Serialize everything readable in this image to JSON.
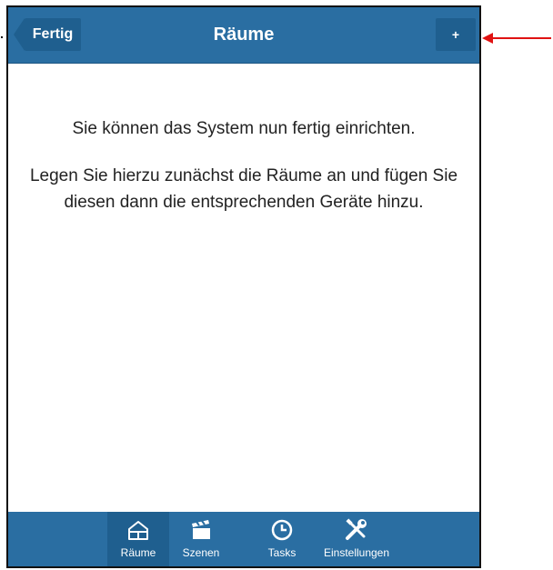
{
  "header": {
    "back_label": "Fertig",
    "title": "Räume",
    "add_label": "+"
  },
  "content": {
    "line1": "Sie können das System nun fertig einrichten.",
    "line2": "Legen Sie hierzu zunächst die Räume an und fügen Sie diesen dann die entsprechenden Geräte hinzu."
  },
  "tabs": [
    {
      "label": "Räume",
      "icon": "house-icon",
      "active": true
    },
    {
      "label": "Szenen",
      "icon": "clapperboard-icon",
      "active": false
    },
    {
      "label": "Tasks",
      "icon": "clock-icon",
      "active": false
    },
    {
      "label": "Einstellungen",
      "icon": "tools-icon",
      "active": false
    }
  ],
  "colors": {
    "bar": "#2a6ea2",
    "bar_dark": "#1f5f8f",
    "annotation_arrow": "#e01212"
  }
}
